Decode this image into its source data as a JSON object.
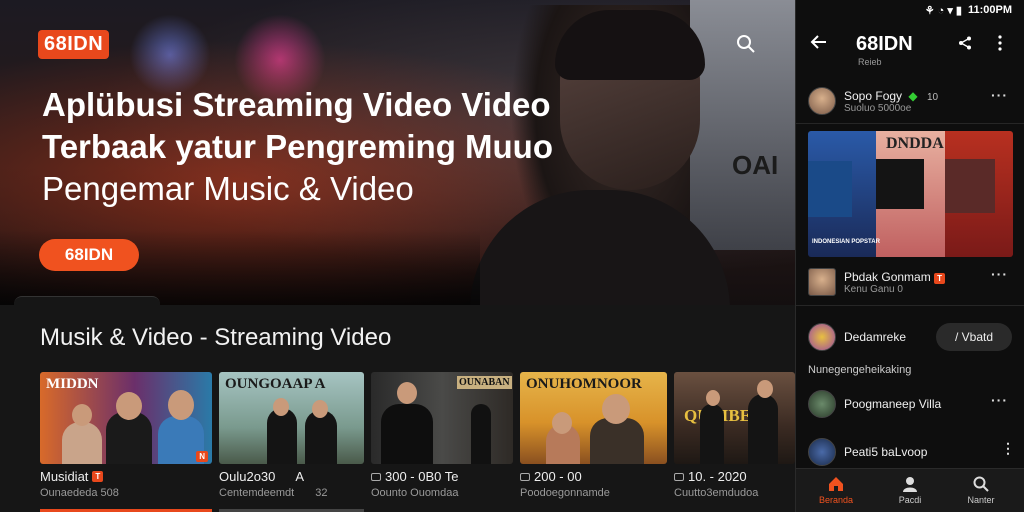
{
  "header": {
    "logo": "68IDN",
    "title_line1": "Aplübusi Streaming Video Video",
    "title_line2": "Terbaak yatur Pengreming Muuo",
    "title_line3": "Pengemar Music & Video",
    "cta_label": "68IDN",
    "hero_screen_text": "OAI"
  },
  "section": {
    "title": "Musik & Video - Streaming Video",
    "cards": [
      {
        "banner": "MIDDN",
        "name": "Musidiat",
        "badge": "T",
        "sub": "Ounaededa 508",
        "hot": "N"
      },
      {
        "banner": "OUNGOAAP A",
        "name": "Oulu2o30",
        "extra": "A",
        "sub": "Centemdeemdt",
        "sub_extra": "32"
      },
      {
        "banner": "OUNABAN",
        "name": "300 - 0B0 Te",
        "sub": "Oounto Ouomdaa"
      },
      {
        "banner": "ONUHOMNOOR",
        "name": "200 - 00",
        "sub": "Poodoegonnamde"
      },
      {
        "banner": "QUNIBEO",
        "name": "10. - 2020",
        "sub": "Cuutto3emdudoa"
      }
    ]
  },
  "phone": {
    "status": "11:00PM",
    "title": "68IDN",
    "subtitle": "Reieb",
    "item1": {
      "name": "Sopo Fogy",
      "tag": "10",
      "meta": "Suoluo 5000oe"
    },
    "video": {
      "title": "DNDDA",
      "subtitle": "INDONESIAN POPSTAR"
    },
    "item2": {
      "name": "Pbdak Gonmam",
      "badge": "T",
      "meta": "Kenu Ganu 0"
    },
    "item3": {
      "name": "Dedamreke",
      "button": "/ Vbatd"
    },
    "plain": "Nunegengeheikaking",
    "item4": {
      "name": "Poogmaneep Villa"
    },
    "item5": {
      "name": "Peati5 baLvoop"
    },
    "tabs": [
      {
        "label": "Beranda",
        "icon": "home-icon"
      },
      {
        "label": "Pacdi",
        "icon": "user-icon"
      },
      {
        "label": "Nanter",
        "icon": "search-icon"
      }
    ]
  },
  "colors": {
    "accent": "#f0521f",
    "background": "#111111",
    "panel": "#0e0e0e"
  }
}
